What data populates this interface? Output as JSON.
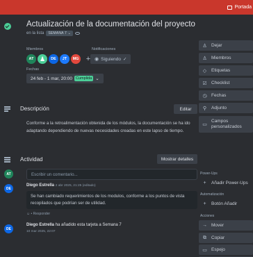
{
  "cover": {
    "button_label": "Portada"
  },
  "card": {
    "title": "Actualización de la documentación del proyecto",
    "list_prefix": "en la lista",
    "list_name": "SEMANA 7"
  },
  "fields": {
    "members_label": "Miembros",
    "members": [
      {
        "initials": "AT",
        "color": "#1f845a"
      },
      {
        "initials": "",
        "color": "#4bce97"
      },
      {
        "initials": "DE",
        "color": "#0c66e4"
      },
      {
        "initials": "JT",
        "color": "#1d7afc"
      },
      {
        "initials": "MG",
        "color": "#e2483d"
      }
    ],
    "add_member": "+",
    "notifications_label": "Notificaciones",
    "follow_label": "Siguiendo",
    "dates_label": "Fechas",
    "date_value": "24 feb - 1 mar, 20:00",
    "date_badge": "Cumplida"
  },
  "description": {
    "heading": "Descripción",
    "edit_label": "Editar",
    "text": "Conforme a la retroalimentación obtenida de los módulos, la documentación se ha ido adaptando dependiendo de nuevas necesidades creadas en este lapso de tiempo."
  },
  "activity": {
    "heading": "Actividad",
    "show_details_label": "Mostrar detalles",
    "current_user": {
      "initials": "AT",
      "color": "#1f845a"
    },
    "comment_placeholder": "Escribir un comentario...",
    "items": [
      {
        "initials": "DE",
        "color": "#0c66e4",
        "author": "Diego Estrella",
        "timestamp": "2 abr 2025, 21:25 (editado)",
        "comment": "Se han cambiado requerimientos de los modulos, conforme a los puntos de vista recopilados que podrían ser de utilidad.",
        "reply_label": "Responder"
      },
      {
        "initials": "DE",
        "color": "#0c66e4",
        "author": "Diego Estrella",
        "action": "ha añadido esta tarjeta a Semana 7",
        "timestamp": "10 mar 2025, 22:07"
      }
    ]
  },
  "sidebar": {
    "items": [
      {
        "label": "Dejar",
        "icon": "person-minus-icon",
        "glyph": "♙"
      },
      {
        "label": "Miembros",
        "icon": "person-icon",
        "glyph": "♙"
      },
      {
        "label": "Etiquetas",
        "icon": "tag-icon",
        "glyph": "◇"
      },
      {
        "label": "Checklist",
        "icon": "checklist-icon",
        "glyph": "☑"
      },
      {
        "label": "Fechas",
        "icon": "clock-icon",
        "glyph": "◷"
      },
      {
        "label": "Adjunto",
        "icon": "paperclip-icon",
        "glyph": "⚲"
      },
      {
        "label": "Campos personalizados",
        "icon": "custom-fields-icon",
        "glyph": "▭"
      }
    ],
    "powerups_label": "Power-Ups",
    "add_powerups_label": "Añadir Power-Ups",
    "automation_label": "Automatización",
    "add_button_label": "Botón Añadir",
    "actions_label": "Acciones",
    "actions": [
      {
        "label": "Mover",
        "icon": "arrow-right-icon",
        "glyph": "→"
      },
      {
        "label": "Copiar",
        "icon": "copy-icon",
        "glyph": "⧉"
      },
      {
        "label": "Espejo",
        "icon": "mirror-icon",
        "glyph": "▭"
      },
      {
        "label": "Crear plantilla",
        "icon": "template-icon",
        "glyph": "▤"
      }
    ]
  }
}
